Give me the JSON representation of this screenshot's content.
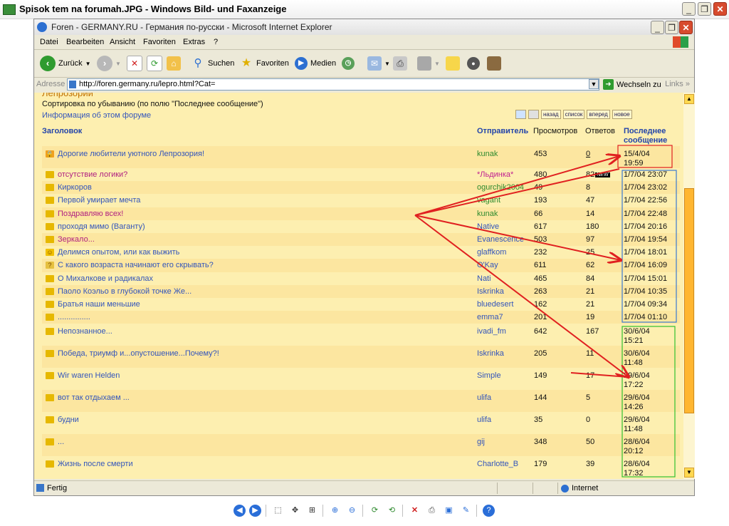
{
  "outer_window": {
    "title": "Spisok tem na forumah.JPG - Windows Bild- und Faxanzeige"
  },
  "ie_window": {
    "title": "Foren - GERMANY.RU - Германия по-русски - Microsoft Internet Explorer"
  },
  "menu": [
    "Datei",
    "Bearbeiten",
    "Ansicht",
    "Favoriten",
    "Extras",
    "?"
  ],
  "toolbar": {
    "back": "Zurück",
    "search": "Suchen",
    "favorites": "Favoriten",
    "media": "Medien"
  },
  "address": {
    "label": "Adresse",
    "url": "http://foren.germany.ru/lepro.html?Cat=",
    "go": "Wechseln zu",
    "links": "Links"
  },
  "forum": {
    "heading": "Лепрозорий",
    "sort_text": "Сортировка по убыванию (по полю \"Последнее сообщение\")",
    "info_link": "Информация об этом форуме",
    "nav_buttons": [
      "назад",
      "список",
      "вперед",
      "новое"
    ],
    "columns": {
      "title": "Заголовок",
      "author": "Отправитель",
      "views": "Просмотров",
      "replies": "Ответов",
      "last": "Последнее сообщение"
    },
    "rows": [
      {
        "title": "Дорогие любители уютного Лепрозория!",
        "author": "kunak",
        "views": "453",
        "replies": "0",
        "last": "15/4/04 19:59",
        "icon": "lock-icon"
      },
      {
        "title": "отсутствие логики?",
        "author": "*Льдинка*",
        "views": "480",
        "replies": "82",
        "new_badge": "NEW",
        "last": "1/7/04 23:07",
        "icon": "book-icon"
      },
      {
        "title": "Киркоров",
        "author": "ogurchik2004",
        "views": "49",
        "replies": "8",
        "last": "1/7/04 23:02",
        "icon": "book-icon"
      },
      {
        "title": "Первой умирает мечта",
        "author": "vagant",
        "views": "193",
        "replies": "47",
        "last": "1/7/04 22:56",
        "icon": "book-icon"
      },
      {
        "title": "Поздравляю всех!",
        "author": "kunak",
        "views": "66",
        "replies": "14",
        "last": "1/7/04 22:48",
        "icon": "book-icon"
      },
      {
        "title": "проходя мимо (Ваганту)",
        "author": "Native",
        "views": "617",
        "replies": "180",
        "last": "1/7/04 20:16",
        "icon": "book-icon"
      },
      {
        "title": "Зеркало...",
        "author": "Evanescence",
        "views": "503",
        "replies": "97",
        "last": "1/7/04 19:54",
        "icon": "book-icon"
      },
      {
        "title": "Делимся опытом, или как выжить",
        "author": "glaffkom",
        "views": "232",
        "replies": "25",
        "last": "1/7/04 18:01",
        "icon": "smiley-icon"
      },
      {
        "title": "С какого возраста начинают его скрывать?",
        "author": "O'Kay",
        "views": "611",
        "replies": "62",
        "last": "1/7/04 16:09",
        "icon": "question-icon"
      },
      {
        "title": "О Михалкове и радикалах",
        "author": "Nati",
        "views": "465",
        "replies": "84",
        "last": "1/7/04 15:01",
        "icon": "book-icon"
      },
      {
        "title": "Паоло Коэльо в глубокой точке Же...",
        "author": "Iskrinka",
        "views": "263",
        "replies": "21",
        "last": "1/7/04 10:35",
        "icon": "book-icon"
      },
      {
        "title": "Братья наши меньшие",
        "author": "bluedesert",
        "views": "162",
        "replies": "21",
        "last": "1/7/04 09:34",
        "icon": "book-icon"
      },
      {
        "title": "...............",
        "author": "emma7",
        "views": "201",
        "replies": "19",
        "last": "1/7/04 01:10",
        "icon": "book-icon"
      },
      {
        "title": "Непознанное...",
        "author": "ivadi_fm",
        "views": "642",
        "replies": "167",
        "last": "30/6/04 15:21",
        "icon": "book-icon"
      },
      {
        "title": "Победа, триумф и...опустошение...Почему?!",
        "author": "Iskrinka",
        "views": "205",
        "replies": "11",
        "last": "30/6/04 11:48",
        "icon": "book-icon"
      },
      {
        "title": "Wir waren Helden",
        "author": "Simple",
        "views": "149",
        "replies": "17",
        "last": "29/6/04 17:22",
        "icon": "book-icon"
      },
      {
        "title": "вот так отдыхаем ...",
        "author": "ulifa",
        "views": "144",
        "replies": "5",
        "last": "29/6/04 14:26",
        "icon": "book-icon"
      },
      {
        "title": "будни",
        "author": "ulifa",
        "views": "35",
        "replies": "0",
        "last": "29/6/04 11:48",
        "icon": "book-icon"
      },
      {
        "title": "...",
        "author": "gij",
        "views": "348",
        "replies": "50",
        "last": "28/6/04 20:12",
        "icon": "book-icon"
      },
      {
        "title": "Жизнь после смерти",
        "author": "Charlotte_B",
        "views": "179",
        "replies": "39",
        "last": "28/6/04 17:32",
        "icon": "book-icon"
      }
    ]
  },
  "status": {
    "text": "Fertig",
    "zone": "Internet"
  },
  "colors": {
    "page_bg": "#fdefb0",
    "link": "#3355bb",
    "author": "#2e8a2e",
    "arrow": "#e02020",
    "box_blue": "#3a7ad0",
    "box_green": "#30c030"
  }
}
